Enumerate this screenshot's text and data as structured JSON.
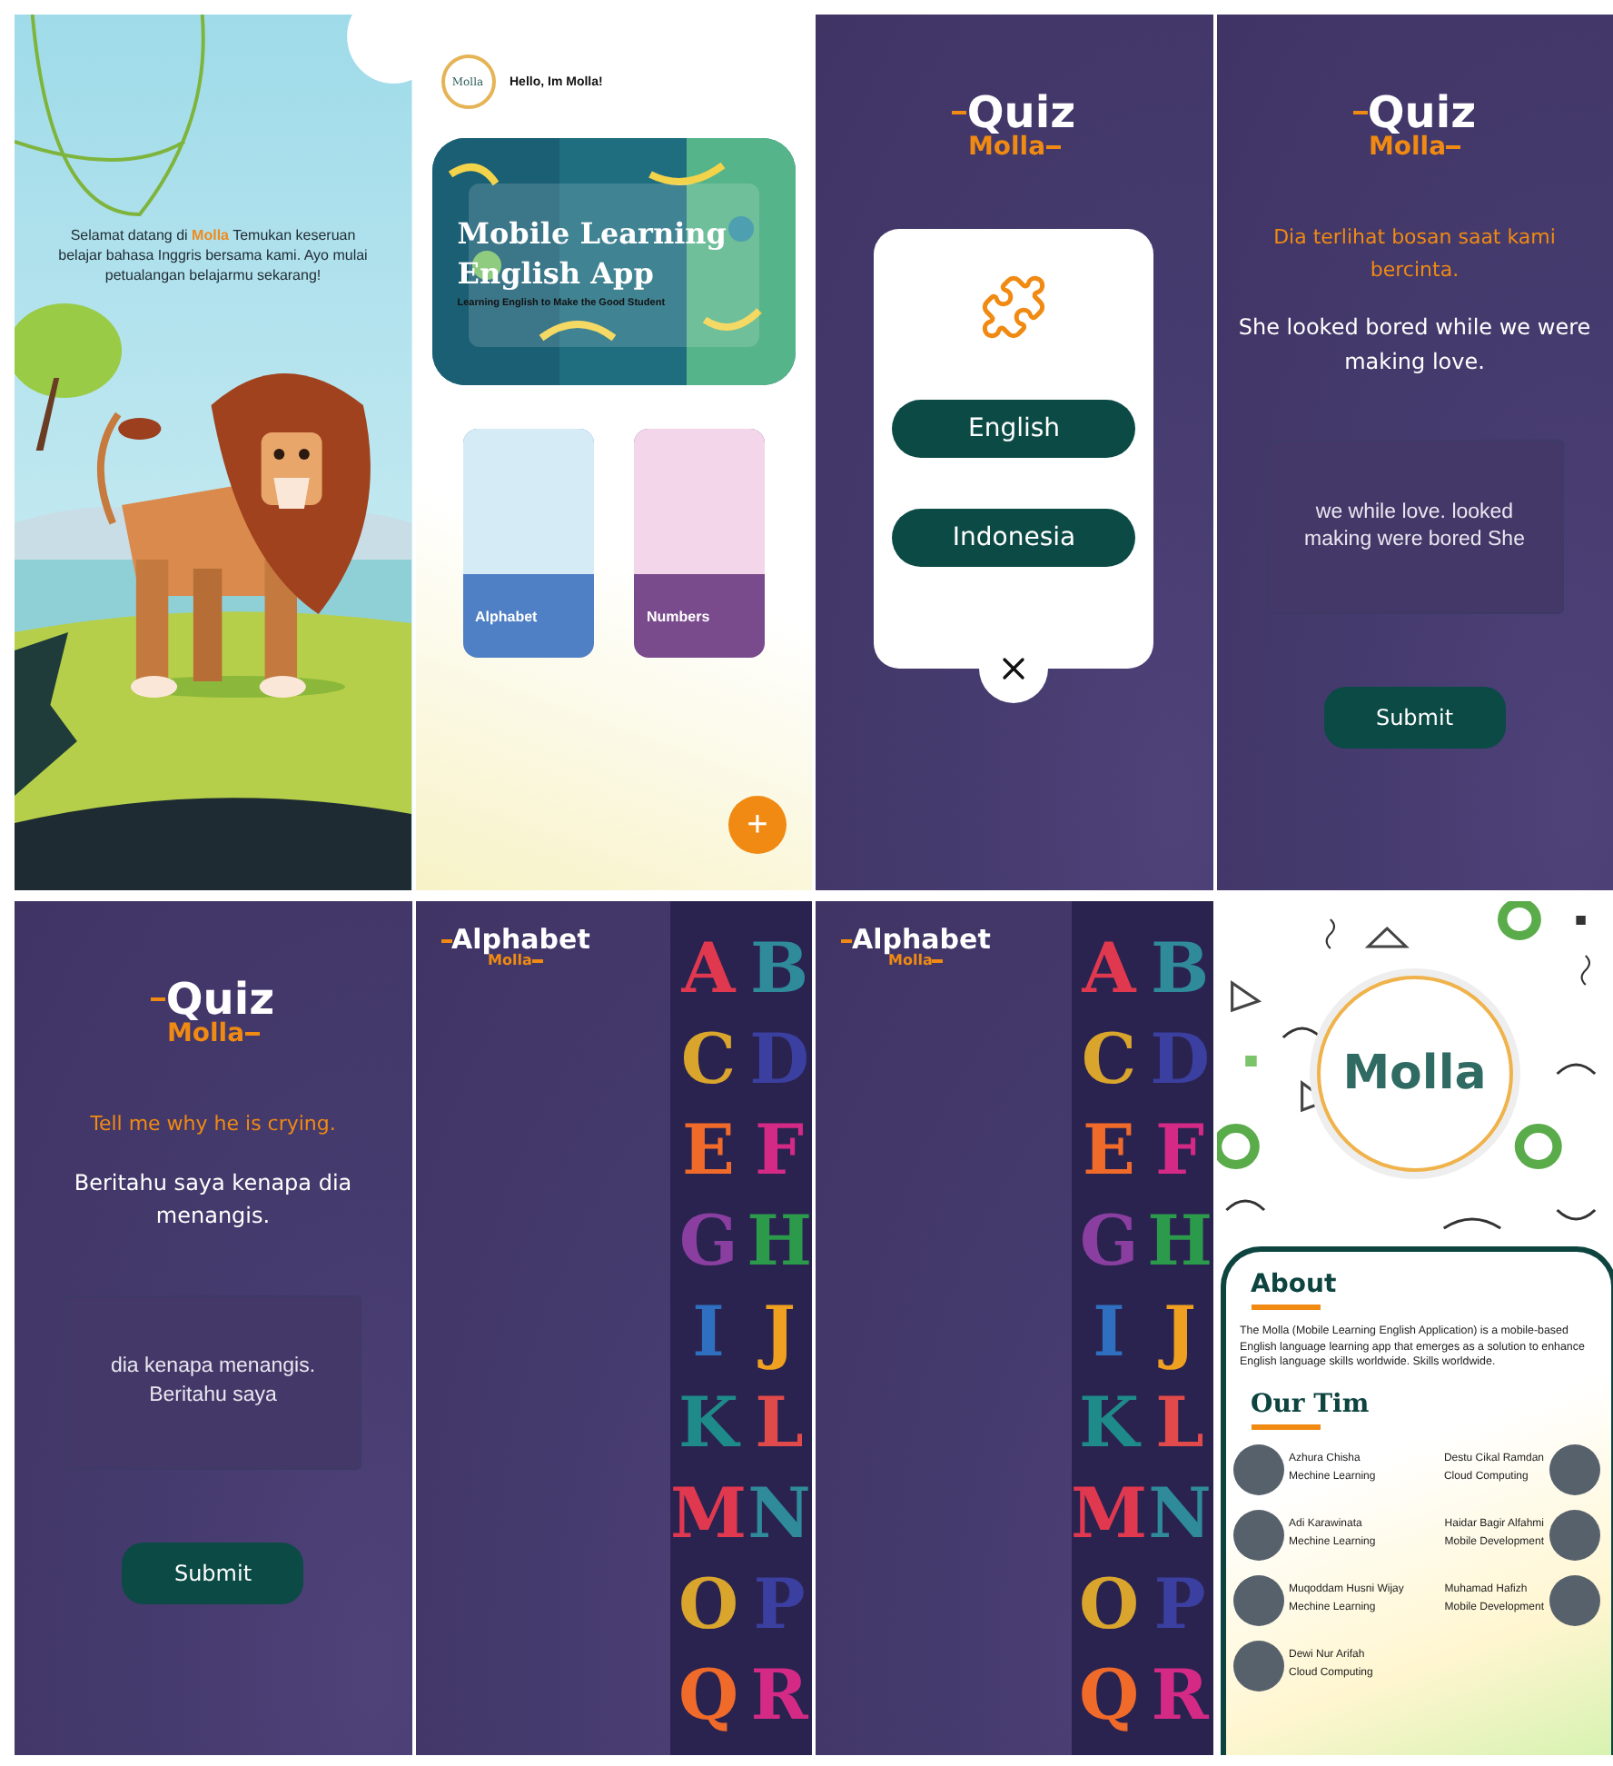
{
  "screens": [
    {
      "kind": "splash",
      "message_start": "Selamat datang di",
      "highlight": "Molla",
      "message_end": "Temukan keseruan belajar bahasa Inggris bersama kami. Ayo mulai petualangan belajarmu sekarang!"
    },
    {
      "kind": "home",
      "avatar_logo": "Molla",
      "greeting": "Hello, Im Molla!",
      "banner": {
        "title": "Mobile Learning English App",
        "subtitle": "Learning English to Make the Good Student"
      },
      "categories": [
        {
          "label": "Alphabet",
          "color": "#4f7fc4"
        },
        {
          "label": "Numbers",
          "color": "#7a4b8c"
        }
      ],
      "fab": "+"
    },
    {
      "kind": "language_picker",
      "logo": {
        "title": "Quiz",
        "subtitle": "Molla"
      },
      "options": [
        "English",
        "Indonesia"
      ]
    },
    {
      "kind": "quiz",
      "logo": {
        "title": "Quiz",
        "subtitle": "Molla"
      },
      "prompt": "Dia terlihat bosan saat kami bercinta.",
      "sentence": "She looked bored while we were making love.",
      "answer": "we while love. looked making were bored She",
      "button": "Submit"
    },
    {
      "kind": "quiz",
      "logo": {
        "title": "Quiz",
        "subtitle": "Molla"
      },
      "prompt": "Tell me why he is crying.",
      "sentence": "Beritahu saya kenapa dia menangis.",
      "answer": "dia kenapa menangis. Beritahu saya",
      "button": "Submit"
    },
    {
      "kind": "alphabet",
      "logo": {
        "title": "Alphabet",
        "subtitle": "Molla"
      },
      "letters": [
        "A",
        "B",
        "C",
        "D",
        "E",
        "F",
        "G",
        "H",
        "I",
        "J",
        "K",
        "L",
        "M",
        "N",
        "O",
        "P",
        "Q",
        "R"
      ]
    },
    {
      "kind": "alphabet",
      "logo": {
        "title": "Alphabet",
        "subtitle": "Molla"
      },
      "letters": [
        "A",
        "B",
        "C",
        "D",
        "E",
        "F",
        "G",
        "H",
        "I",
        "J",
        "K",
        "L",
        "M",
        "N",
        "O",
        "P",
        "Q",
        "R"
      ]
    },
    {
      "kind": "about",
      "logo": "Molla",
      "about_heading": "About",
      "about_text": "The Molla (Mobile Learning English Application) is a mobile-based English language learning app that emerges as a solution to enhance English language skills worldwide. Skills worldwide.",
      "team_heading": "Our Tim",
      "members": [
        {
          "name": "Azhura Chisha",
          "role": "Mechine Learning"
        },
        {
          "name": "Destu Cikal Ramdan",
          "role": "Cloud Computing"
        },
        {
          "name": "Adi Karawinata",
          "role": "Mechine Learning"
        },
        {
          "name": "Haidar Bagir Alfahmi",
          "role": "Mobile Development"
        },
        {
          "name": "Muqoddam Husni Wijay",
          "role": "Mechine Learning"
        },
        {
          "name": "Muhamad Hafizh",
          "role": "Mobile Development"
        },
        {
          "name": "Dewi Nur Arifah",
          "role": "Cloud Computing"
        }
      ]
    }
  ]
}
